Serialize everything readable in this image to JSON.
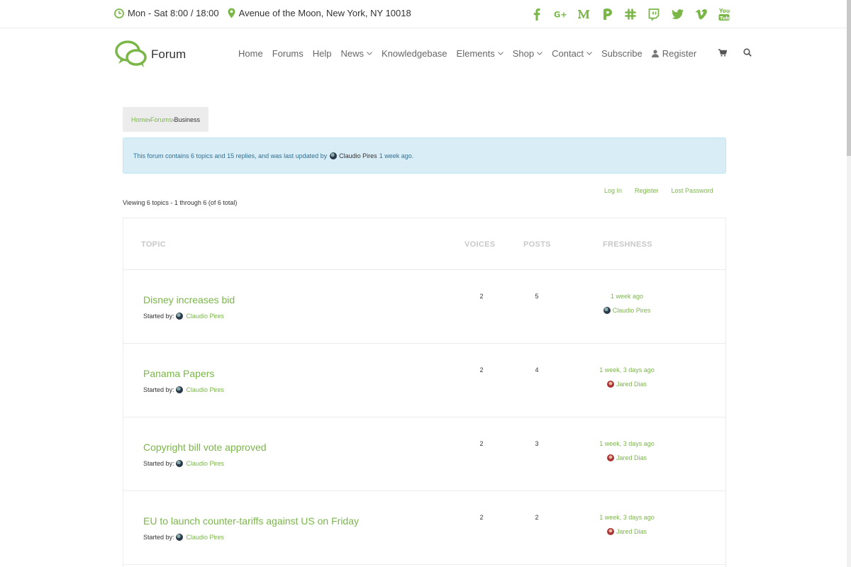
{
  "topbar": {
    "hours": "Mon - Sat 8:00 / 18:00",
    "address": "Avenue of the Moon, New York, NY 10018",
    "social": [
      "facebook-icon",
      "google-plus-icon",
      "medium-icon",
      "patreon-icon",
      "slack-icon",
      "twitch-icon",
      "twitter-icon",
      "vimeo-icon",
      "youtube-icon"
    ]
  },
  "header": {
    "logo_text": "Forum",
    "nav": {
      "home": "Home",
      "forums": "Forums",
      "help": "Help",
      "news": "News",
      "knowledgebase": "Knowledgebase",
      "elements": "Elements",
      "shop": "Shop",
      "contact": "Contact",
      "subscribe": "Subscribe",
      "register": "Register"
    }
  },
  "breadcrumb": {
    "home": "Home",
    "forums": "Forums",
    "current": "Business",
    "sep": "›"
  },
  "info": {
    "text_before": "This forum contains 6 topics and 15 replies, and was last updated by",
    "user": "Claudio Pires",
    "text_after": "1 week ago."
  },
  "auth": {
    "login": "Log In",
    "register": "Register",
    "lost_password": "Lost Password"
  },
  "viewing": "Viewing 6 topics - 1 through 6 (of 6 total)",
  "table": {
    "headers": {
      "topic": "TOPIC",
      "voices": "VOICES",
      "posts": "POSTS",
      "freshness": "FRESHNESS"
    },
    "started_by_label": "Started by:",
    "rows": [
      {
        "title": "Disney increases bid",
        "author": "Claudio Pires",
        "voices": "2",
        "posts": "5",
        "freshness": "1 week ago",
        "last_user": "Claudio Pires"
      },
      {
        "title": "Panama Papers",
        "author": "Claudio Pires",
        "voices": "2",
        "posts": "4",
        "freshness": "1 week, 3 days ago",
        "last_user": "Jared Dias"
      },
      {
        "title": "Copyright bill vote approved",
        "author": "Claudio Pires",
        "voices": "2",
        "posts": "3",
        "freshness": "1 week, 3 days ago",
        "last_user": "Jared Dias"
      },
      {
        "title": "EU to launch counter-tariffs against US on Friday",
        "author": "Claudio Pires",
        "voices": "2",
        "posts": "2",
        "freshness": "1 week, 3 days ago",
        "last_user": "Jared Dias"
      }
    ]
  },
  "colors": {
    "accent": "#7ab648",
    "info_bg": "#d9edf7",
    "info_text": "#31708f"
  }
}
